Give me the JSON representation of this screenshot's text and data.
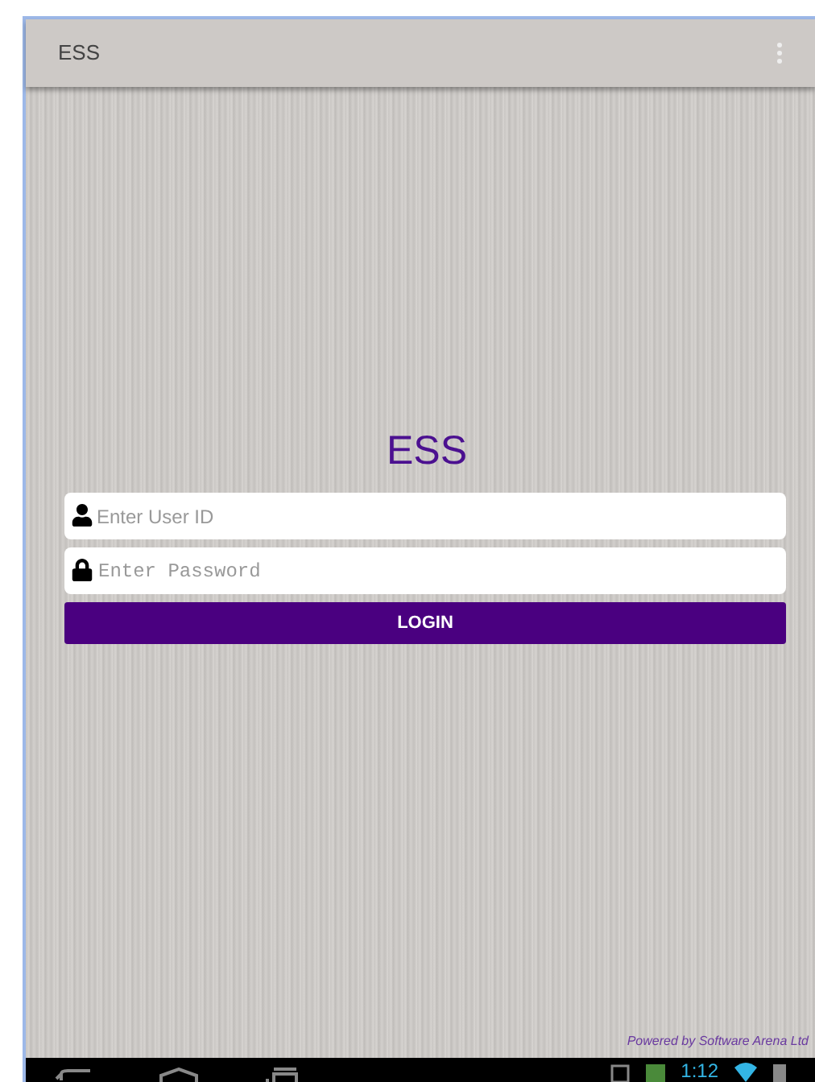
{
  "app_bar": {
    "title": "ESS"
  },
  "login": {
    "title": "ESS",
    "user_field": {
      "placeholder": "Enter User ID"
    },
    "password_field": {
      "placeholder": "Enter Password"
    },
    "button": "LOGIN"
  },
  "footer": "Powered by Software Arena Ltd",
  "status_bar": {
    "time": "1:12"
  }
}
